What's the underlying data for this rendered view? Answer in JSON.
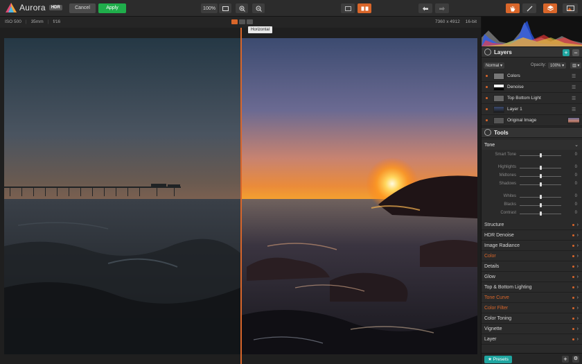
{
  "app": {
    "logo_text": "Aurora",
    "logo_badge": "HDR",
    "cancel_label": "Cancel",
    "apply_label": "Apply",
    "zoom_label": "100%",
    "colors": {
      "accent": "#d9662a",
      "apply_green": "#1fae4b",
      "presets_teal": "#1fa5a0",
      "layers_plus": "#1fa5a0"
    }
  },
  "info": {
    "iso": "ISO 500",
    "focal": "35mm",
    "aperture": "f/16",
    "dimensions": "7360 x 4912",
    "bit_depth": "16-bit",
    "tooltip": "Horizontal"
  },
  "layers": {
    "title": "Layers",
    "blend_mode": "Normal",
    "opacity_label": "Opacity:",
    "opacity_value": "100%",
    "items": [
      {
        "name": "Colors"
      },
      {
        "name": "Denoise"
      },
      {
        "name": "Top Bottom Light"
      },
      {
        "name": "Layer 1"
      },
      {
        "name": "Original Image"
      }
    ]
  },
  "tools": {
    "title": "Tools",
    "tone": {
      "title": "Tone",
      "sliders": [
        {
          "label": "Smart Tone",
          "value": "0",
          "level": 0.5
        },
        {
          "label": "Highlights",
          "value": "0",
          "level": 0.5
        },
        {
          "label": "Midtones",
          "value": "0",
          "level": 0.5
        },
        {
          "label": "Shadows",
          "value": "0",
          "level": 0.5
        },
        {
          "label": "Whites",
          "value": "0",
          "level": 0.5
        },
        {
          "label": "Blacks",
          "value": "0",
          "level": 0.5
        },
        {
          "label": "Contrast",
          "value": "0",
          "level": 0.5
        }
      ]
    },
    "filters": [
      {
        "name": "Structure",
        "active": false
      },
      {
        "name": "HDR Denoise",
        "active": false
      },
      {
        "name": "Image Radiance",
        "active": false
      },
      {
        "name": "Color",
        "active": true
      },
      {
        "name": "Details",
        "active": false
      },
      {
        "name": "Glow",
        "active": false
      },
      {
        "name": "Top & Bottom Lighting",
        "active": false
      },
      {
        "name": "Tone Curve",
        "active": true
      },
      {
        "name": "Color Filter",
        "active": true
      },
      {
        "name": "Color Toning",
        "active": false
      },
      {
        "name": "Vignette",
        "active": false
      },
      {
        "name": "Layer",
        "active": false
      }
    ]
  },
  "presets": {
    "label": "★ Presets"
  }
}
